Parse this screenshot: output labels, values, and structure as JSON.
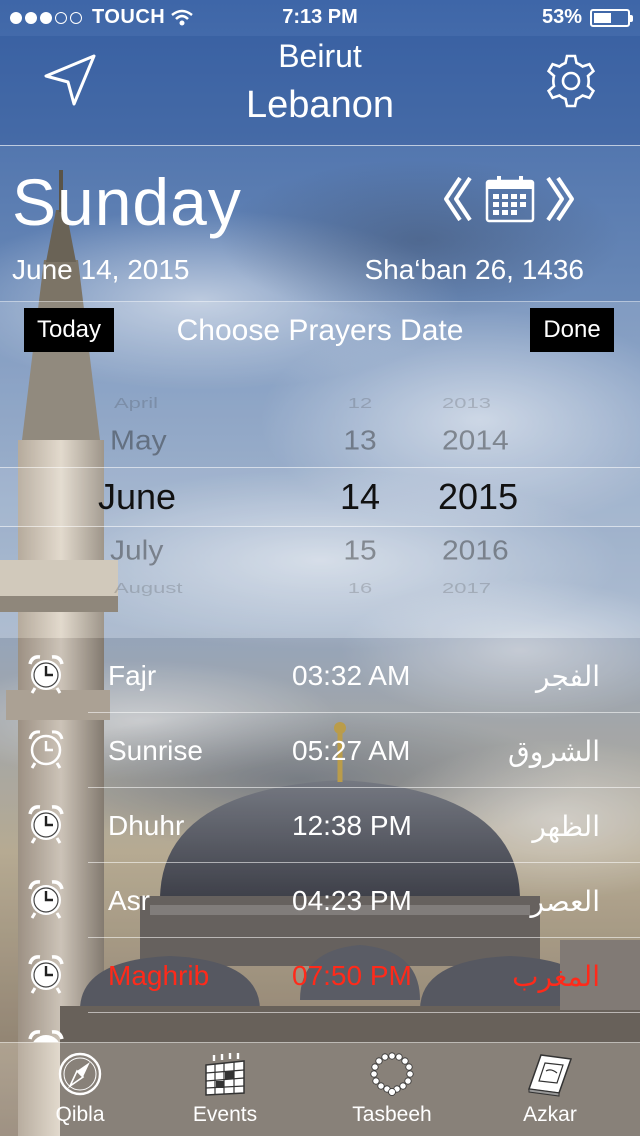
{
  "status_bar": {
    "carrier": "TOUCH",
    "time": "7:13 PM",
    "battery": "53%",
    "battery_level": 0.53
  },
  "header": {
    "city": "Beirut",
    "country": "Lebanon",
    "location_icon": "location-arrow-icon",
    "settings_icon": "gear-icon"
  },
  "date": {
    "day_name": "Sunday",
    "gregorian": "June 14, 2015",
    "hijri": "Sha‘ban 26, 1436"
  },
  "picker": {
    "today_label": "Today",
    "done_label": "Done",
    "title": "Choose Prayers Date",
    "months": [
      "April",
      "May",
      "June",
      "July",
      "August"
    ],
    "days": [
      "12",
      "13",
      "14",
      "15",
      "16"
    ],
    "years": [
      "2013",
      "2014",
      "2015",
      "2016",
      "2017"
    ]
  },
  "prayers": [
    {
      "name": "Fajr",
      "time": "03:32 AM",
      "arabic": "الفجر",
      "active": false
    },
    {
      "name": "Sunrise",
      "time": "05:27 AM",
      "arabic": "الشروق",
      "active": false
    },
    {
      "name": "Dhuhr",
      "time": "12:38 PM",
      "arabic": "الظهر",
      "active": false
    },
    {
      "name": "Asr",
      "time": "04:23 PM",
      "arabic": "العصر",
      "active": false
    },
    {
      "name": "Maghrib",
      "time": "07:50 PM",
      "arabic": "المغرب",
      "active": true
    }
  ],
  "colors": {
    "active_prayer": "#ff2a1a",
    "header_tint": "#285096"
  },
  "tabs": [
    {
      "label": "Qibla",
      "icon": "compass-icon"
    },
    {
      "label": "Events",
      "icon": "calendar-icon"
    },
    {
      "label": "Tasbeeh",
      "icon": "prayer-beads-icon"
    },
    {
      "label": "Azkar",
      "icon": "book-icon"
    }
  ]
}
